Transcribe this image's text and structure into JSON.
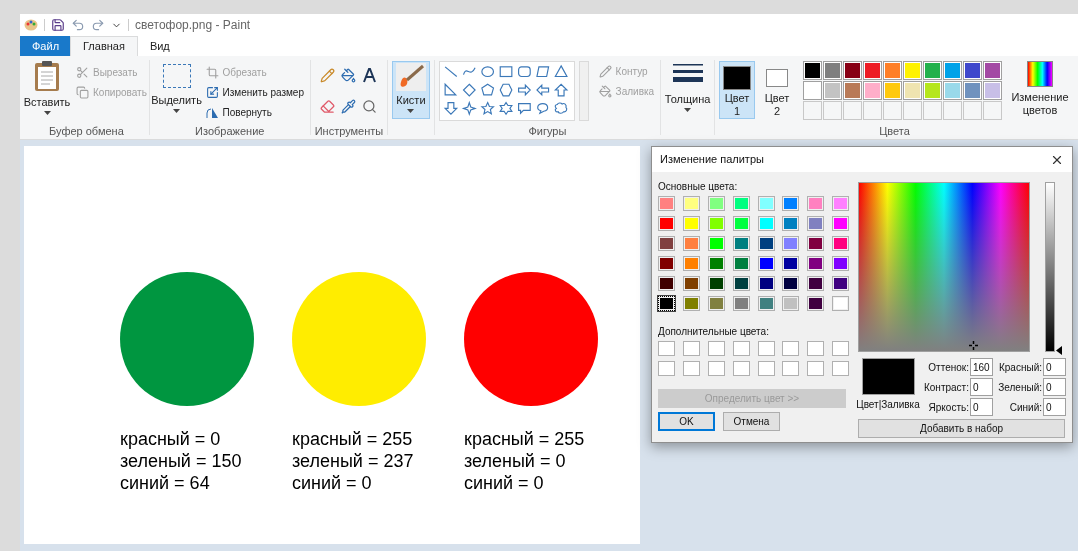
{
  "window": {
    "title": "светофор.png - Paint"
  },
  "tabs": [
    {
      "label": "Файл",
      "kind": "file",
      "selected": false
    },
    {
      "label": "Главная",
      "kind": "tab",
      "selected": true
    },
    {
      "label": "Вид",
      "kind": "tab",
      "selected": false
    }
  ],
  "ribbon": {
    "clipboard": {
      "label": "Буфер обмена",
      "paste": "Вставить",
      "cut": {
        "label": "Вырезать",
        "disabled": true
      },
      "copy": {
        "label": "Копировать",
        "disabled": true
      }
    },
    "image": {
      "label": "Изображение",
      "select": "Выделить",
      "crop": {
        "label": "Обрезать",
        "disabled": true
      },
      "resize": {
        "label": "Изменить размер",
        "disabled": false
      },
      "rotate": {
        "label": "Повернуть",
        "disabled": false
      }
    },
    "tools": {
      "label": "Инструменты"
    },
    "brushes": {
      "label": "Кисти",
      "selected": true
    },
    "shapes": {
      "label": "Фигуры",
      "outline": {
        "label": "Контур",
        "disabled": true
      },
      "fill": {
        "label": "Заливка",
        "disabled": true
      }
    },
    "thickness": {
      "label": "Толщина"
    },
    "colors": {
      "label": "Цвета",
      "color1": {
        "label": "Цвет",
        "number": "1",
        "color": "#000000",
        "selected": true
      },
      "color2": {
        "label": "Цвет",
        "number": "2",
        "color": "#ffffff",
        "selected": false
      },
      "palette": [
        {
          "color": "#000000"
        },
        {
          "color": "#7f7f7f"
        },
        {
          "color": "#880015"
        },
        {
          "color": "#ed1c24"
        },
        {
          "color": "#ff7f27"
        },
        {
          "color": "#fff200"
        },
        {
          "color": "#22b14c"
        },
        {
          "color": "#00a2e8"
        },
        {
          "color": "#3f48cc"
        },
        {
          "color": "#a349a4"
        },
        {
          "color": "#ffffff"
        },
        {
          "color": "#c3c3c3"
        },
        {
          "color": "#b97a57"
        },
        {
          "color": "#ffaec9"
        },
        {
          "color": "#ffc90e"
        },
        {
          "color": "#efe4b0"
        },
        {
          "color": "#b5e61d"
        },
        {
          "color": "#99d9ea"
        },
        {
          "color": "#7092be"
        },
        {
          "color": "#c8bfe7"
        }
      ],
      "edit": "Изменение цветов"
    }
  },
  "canvas": {
    "lights": [
      {
        "color": "#009640",
        "lines": [
          "красный = 0",
          "зеленый = 150",
          "синий = 64"
        ]
      },
      {
        "color": "#ffed00",
        "lines": [
          "красный = 255",
          "зеленый = 237",
          "синий = 0"
        ]
      },
      {
        "color": "#ff0000",
        "lines": [
          "красный = 255",
          "зеленый = 0",
          "синий = 0"
        ]
      }
    ]
  },
  "dialog": {
    "title": "Изменение палитры",
    "basic_label": "Основные цвета:",
    "basic_colors": [
      {
        "color": "#ff8080",
        "selected": false
      },
      {
        "color": "#ffff80",
        "selected": false
      },
      {
        "color": "#80ff80",
        "selected": false
      },
      {
        "color": "#00ff80",
        "selected": false
      },
      {
        "color": "#80ffff",
        "selected": false
      },
      {
        "color": "#0080ff",
        "selected": false
      },
      {
        "color": "#ff80c0",
        "selected": false
      },
      {
        "color": "#ff80ff",
        "selected": false
      },
      {
        "color": "#ff0000",
        "selected": false
      },
      {
        "color": "#ffff00",
        "selected": false
      },
      {
        "color": "#80ff00",
        "selected": false
      },
      {
        "color": "#00ff40",
        "selected": false
      },
      {
        "color": "#00ffff",
        "selected": false
      },
      {
        "color": "#0080c0",
        "selected": false
      },
      {
        "color": "#8080c0",
        "selected": false
      },
      {
        "color": "#ff00ff",
        "selected": false
      },
      {
        "color": "#804040",
        "selected": false
      },
      {
        "color": "#ff8040",
        "selected": false
      },
      {
        "color": "#00ff00",
        "selected": false
      },
      {
        "color": "#008080",
        "selected": false
      },
      {
        "color": "#004080",
        "selected": false
      },
      {
        "color": "#8080ff",
        "selected": false
      },
      {
        "color": "#800040",
        "selected": false
      },
      {
        "color": "#ff0080",
        "selected": false
      },
      {
        "color": "#800000",
        "selected": false
      },
      {
        "color": "#ff8000",
        "selected": false
      },
      {
        "color": "#008000",
        "selected": false
      },
      {
        "color": "#008040",
        "selected": false
      },
      {
        "color": "#0000ff",
        "selected": false
      },
      {
        "color": "#0000a0",
        "selected": false
      },
      {
        "color": "#800080",
        "selected": false
      },
      {
        "color": "#8000ff",
        "selected": false
      },
      {
        "color": "#400000",
        "selected": false
      },
      {
        "color": "#804000",
        "selected": false
      },
      {
        "color": "#004000",
        "selected": false
      },
      {
        "color": "#004040",
        "selected": false
      },
      {
        "color": "#000080",
        "selected": false
      },
      {
        "color": "#000040",
        "selected": false
      },
      {
        "color": "#400040",
        "selected": false
      },
      {
        "color": "#400080",
        "selected": false
      },
      {
        "color": "#000000",
        "selected": true
      },
      {
        "color": "#808000",
        "selected": false
      },
      {
        "color": "#808040",
        "selected": false
      },
      {
        "color": "#808080",
        "selected": false
      },
      {
        "color": "#408080",
        "selected": false
      },
      {
        "color": "#c0c0c0",
        "selected": false
      },
      {
        "color": "#400040",
        "selected": false
      },
      {
        "color": "#ffffff",
        "selected": false
      }
    ],
    "custom_label": "Дополнительные цвета:",
    "define_button": {
      "label": "Определить цвет >>",
      "disabled": true
    },
    "ok": "OK",
    "cancel": "Отмена",
    "preview": {
      "label": "Цвет|Заливка",
      "color": "#000000"
    },
    "left_fields": [
      {
        "label": "Оттенок:",
        "value": "160"
      },
      {
        "label": "Контраст:",
        "value": "0"
      },
      {
        "label": "Яркость:",
        "value": "0"
      }
    ],
    "right_fields": [
      {
        "label": "Красный:",
        "value": "0"
      },
      {
        "label": "Зеленый:",
        "value": "0"
      },
      {
        "label": "Синий:",
        "value": "0"
      }
    ],
    "add_button": "Добавить в набор"
  }
}
